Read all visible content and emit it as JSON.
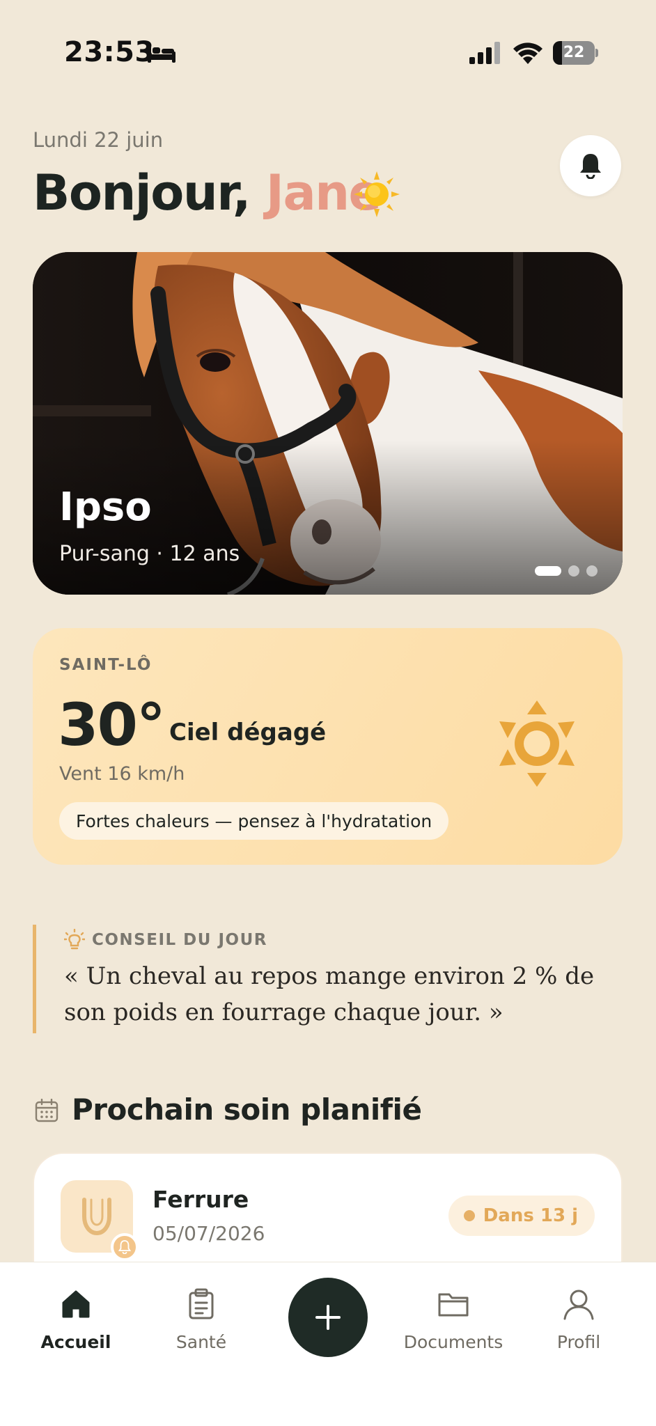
{
  "status_bar": {
    "time": "23:53",
    "battery": "22",
    "battery_level": 0.22,
    "icons": [
      "bed-icon",
      "signal-icon",
      "wifi-icon",
      "battery-icon"
    ]
  },
  "header": {
    "date": "Lundi 22 juin",
    "greeting_prefix": "Bonjour,",
    "user_name": "Jane",
    "greeting_icon": "sun-emoji",
    "notification_icon": "bell-icon"
  },
  "horse": {
    "name": "Ipso",
    "meta": "Pur-sang · 12 ans",
    "carousel_pages": 3,
    "carousel_active_index": 0
  },
  "weather": {
    "city": "SAINT-LÔ",
    "temperature": "30°",
    "condition": "Ciel dégagé",
    "wind": "Vent 16 km/h",
    "alert": "Fortes chaleurs — pensez à l'hydratation",
    "icon": "sun-icon"
  },
  "tip": {
    "title": "CONSEIL DU JOUR",
    "text": "« Un cheval au repos mange environ 2 % de son poids en fourrage chaque jour. »",
    "icon": "lightbulb-icon"
  },
  "next_care": {
    "section_title": "Prochain soin planifié",
    "section_icon": "calendar-icon",
    "item": {
      "title": "Ferrure",
      "date": "05/07/2026",
      "due": "Dans 13 j",
      "icon": "horseshoe-icon",
      "badge_icon": "bell-icon"
    }
  },
  "nav": {
    "items": [
      {
        "label": "Accueil",
        "icon": "home-icon",
        "active": true
      },
      {
        "label": "Santé",
        "icon": "clipboard-icon",
        "active": false
      },
      {
        "label": "Documents",
        "icon": "folder-icon",
        "active": false
      },
      {
        "label": "Profil",
        "icon": "user-icon",
        "active": false
      }
    ],
    "add_icon": "plus-icon"
  },
  "colors": {
    "background": "#F1E8D8",
    "accent_name": "#E79A86",
    "weather_icon": "#E8A53A",
    "tip_border": "#E8B56B",
    "nav_add": "#1F2B26"
  }
}
